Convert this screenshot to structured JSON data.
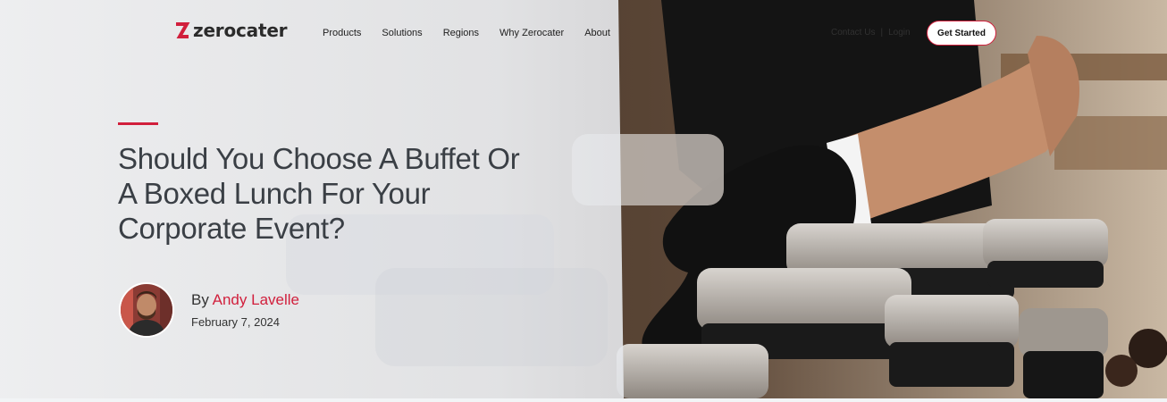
{
  "brand": {
    "name": "zerocater",
    "accent": "#d11f3c"
  },
  "nav": {
    "items": [
      "Products",
      "Solutions",
      "Regions",
      "Why Zerocater",
      "About"
    ],
    "contact": "Contact Us",
    "separator": "|",
    "login": "Login",
    "cta": "Get Started"
  },
  "article": {
    "title": "Should You Choose A Buffet Or A Boxed Lunch For Your Corporate Event?",
    "by": "By",
    "author": "Andy Lavelle",
    "date": "February 7, 2024"
  },
  "icons": {
    "logo": "zerocater-logo-icon",
    "avatar": "author-avatar"
  },
  "colors": {
    "overlay": "#eef0f3",
    "text": "#3a3f45",
    "background_photo": "#2a211b"
  }
}
